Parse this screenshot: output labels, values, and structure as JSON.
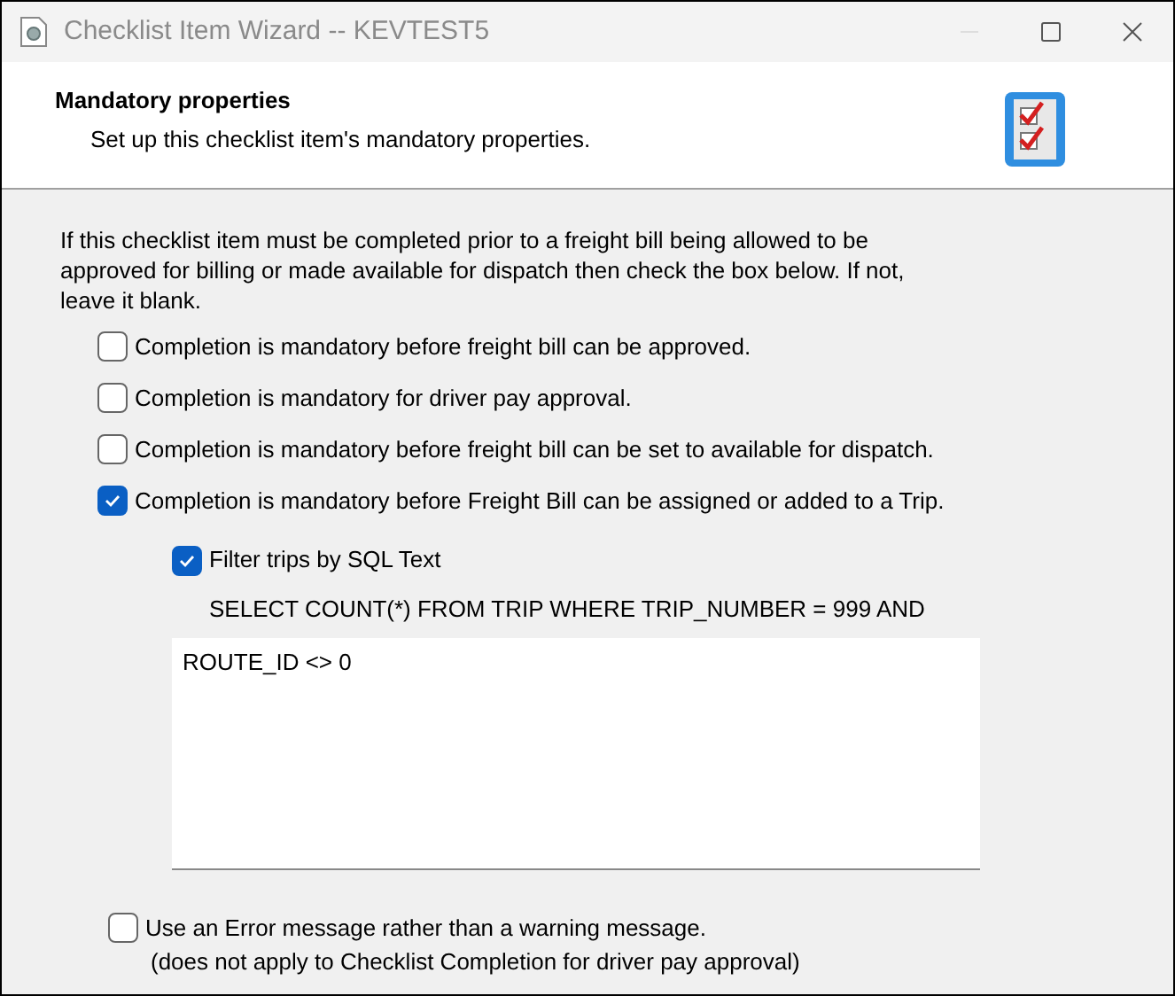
{
  "window": {
    "title": "Checklist Item Wizard -- KEVTEST5"
  },
  "header": {
    "title": "Mandatory properties",
    "subtitle": "Set up this checklist item's mandatory properties."
  },
  "intro": "If this checklist item must be completed prior to a freight bill being allowed to be approved for billing or made available for dispatch then check the box below. If not, leave it blank.",
  "options": [
    {
      "label": "Completion is mandatory before freight bill can be approved.",
      "checked": false
    },
    {
      "label": "Completion is mandatory for driver pay approval.",
      "checked": false
    },
    {
      "label": "Completion is mandatory before freight bill can be set to available for dispatch.",
      "checked": false
    },
    {
      "label": "Completion is mandatory before Freight Bill can be assigned or added to a Trip.",
      "checked": true
    }
  ],
  "filter": {
    "label": "Filter trips by SQL Text",
    "checked": true,
    "sql_prefix": "SELECT COUNT(*) FROM TRIP WHERE TRIP_NUMBER = 999 AND",
    "sql_text": "ROUTE_ID <> 0"
  },
  "error_option": {
    "label": "Use an Error message rather than a warning message.",
    "note": "(does not apply to Checklist Completion for driver pay approval)",
    "checked": false
  }
}
